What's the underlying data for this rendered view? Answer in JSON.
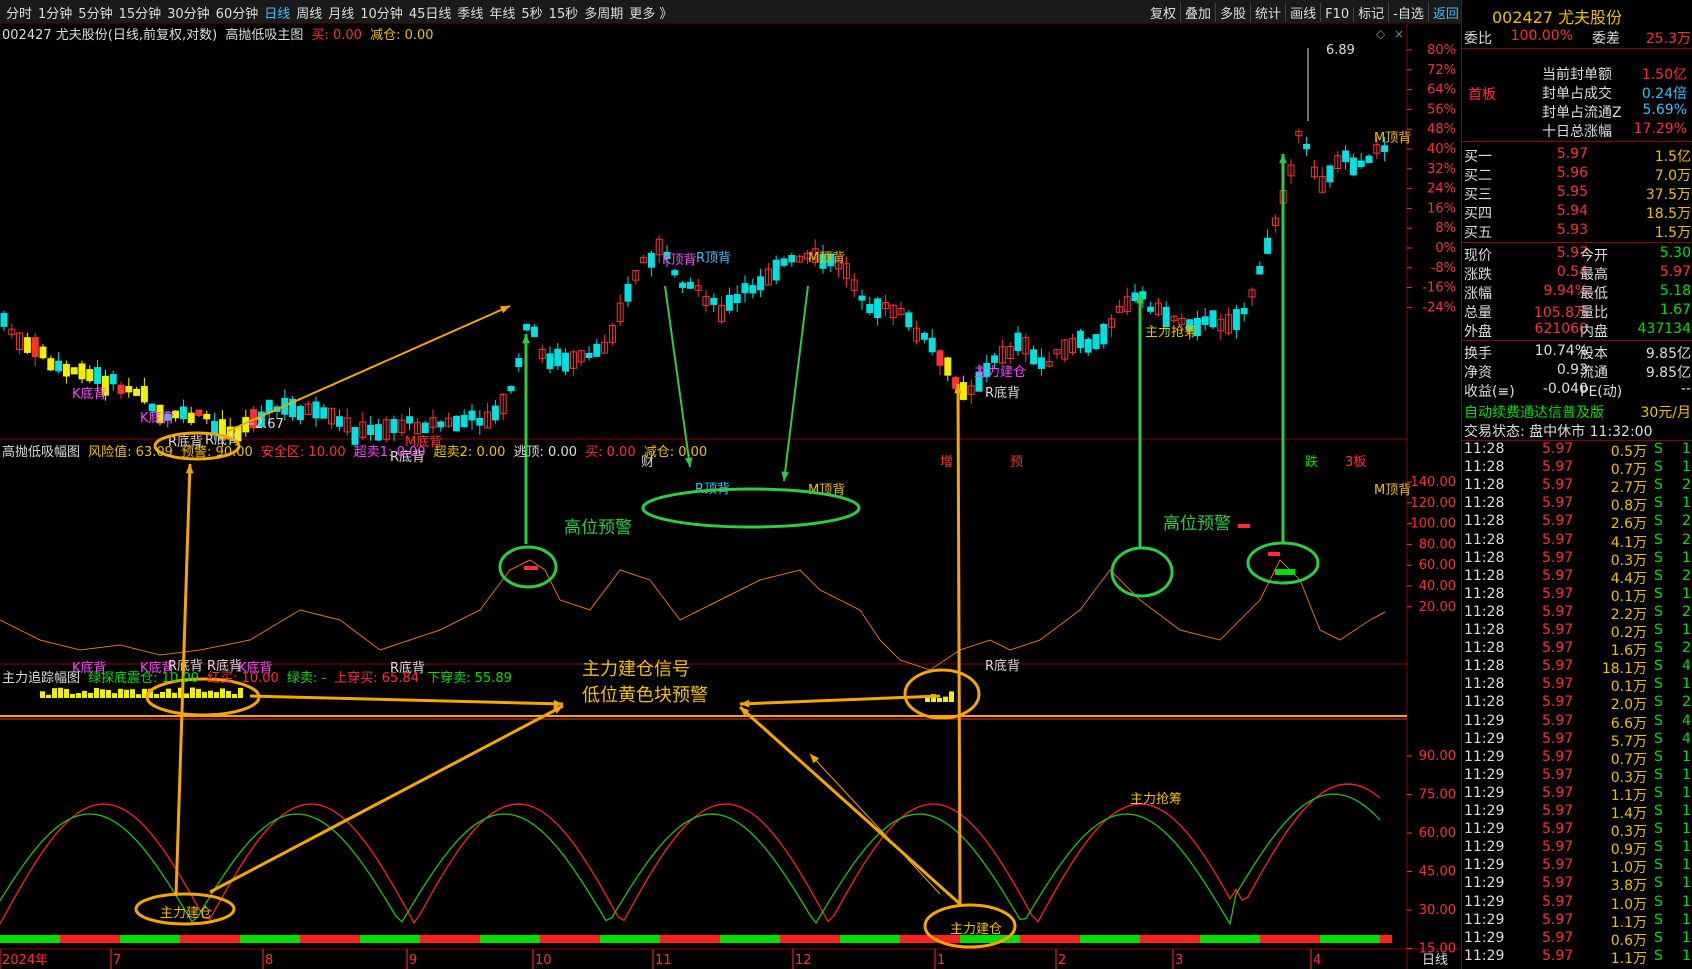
{
  "toolbar": {
    "tabs": [
      "分时",
      "1分钟",
      "5分钟",
      "15分钟",
      "30分钟",
      "60分钟",
      "日线",
      "周线",
      "月线",
      "10分钟",
      "45日线",
      "季线",
      "年线",
      "5秒",
      "15秒",
      "多周期",
      "更多 》"
    ],
    "active_tab": "日线",
    "right_buttons": [
      "复权",
      "叠加",
      "多股",
      "统计",
      "画线",
      "F10",
      "标记",
      "-自选"
    ],
    "back": "返回"
  },
  "main_panel": {
    "title": "002427 尤夫股份(日线,前复权,对数)",
    "indicator": "高抛低吸主图",
    "buy": "买: 0.00",
    "reduce": "减仓: 0.00",
    "right_axis": [
      "80%",
      "72%",
      "64%",
      "56%",
      "48%",
      "40%",
      "32%",
      "24%",
      "16%",
      "8%",
      "0%",
      "-8%",
      "-16%",
      "-24%"
    ],
    "max_price": "6.89",
    "min_price": "2.67",
    "labels": {
      "k_bottom": "K底背",
      "r_bottom": "R底背",
      "r_top": "R顶背",
      "m_top": "M顶背",
      "m_bottom": "M底背",
      "k_top": "K顶背",
      "main_build": "主力建仓",
      "main_grab": "主力抢筹",
      "cai": "财",
      "zeng": "增",
      "yu": "预",
      "die": "跌",
      "ban": "3板"
    }
  },
  "mid_panel": {
    "title": "高抛低吸幅图",
    "fields": [
      "风险值: 63.09",
      "预警: 90.00",
      "安全区: 10.00",
      "超卖1: 0.00",
      "超卖2: 0.00",
      "逃顶: 0.00",
      "买: 0.00",
      "减仓: 0.00"
    ],
    "right_axis": [
      "140.00",
      "120.00",
      "100.00",
      "80.00",
      "60.00",
      "40.00",
      "20.00"
    ],
    "annotations": {
      "high_warn": "高位预警",
      "signal1": "主力建仓信号",
      "signal2": "低位黄色块预警"
    }
  },
  "bottom_panel": {
    "title": "主力追踪幅图",
    "fields": [
      "绿探底震仓: 10.00",
      "红买: 10.00",
      "绿卖: -",
      "上穿买: 65.84",
      "下穿卖: 55.89"
    ],
    "right_axis": [
      "90.00",
      "75.00",
      "60.00",
      "45.00",
      "30.00",
      "15.00"
    ]
  },
  "x_axis": {
    "labels": [
      "2024年",
      "7",
      "8",
      "9",
      "10",
      "11",
      "12",
      "1",
      "2",
      "3",
      "4"
    ],
    "period": "日线"
  },
  "quote": {
    "code": "002427 尤夫股份",
    "weibi_label": "委比",
    "weibi": "100.00%",
    "weicha_label": "委差",
    "weicha": "25.3万",
    "first_board": "首板",
    "seal": [
      [
        "当前封单额",
        "1.50亿"
      ],
      [
        "封单占成交",
        "0.24倍"
      ],
      [
        "封单占流通Z",
        "5.69%"
      ],
      [
        "十日总涨幅",
        "17.29%"
      ]
    ],
    "bids": [
      [
        "买一",
        "5.97",
        "1.5亿"
      ],
      [
        "买二",
        "5.96",
        "7.0万"
      ],
      [
        "买三",
        "5.95",
        "37.5万"
      ],
      [
        "买四",
        "5.94",
        "18.5万"
      ],
      [
        "买五",
        "5.93",
        "1.5万"
      ]
    ],
    "stats": [
      [
        "现价",
        "5.97",
        "今开",
        "5.30"
      ],
      [
        "涨跌",
        "0.54",
        "最高",
        "5.97"
      ],
      [
        "涨幅",
        "9.94%",
        "最低",
        "5.18"
      ],
      [
        "总量",
        "105.8万",
        "量比",
        "1.67"
      ],
      [
        "外盘",
        "621060",
        "内盘",
        "437134"
      ]
    ],
    "stats2": [
      [
        "换手",
        "10.74%",
        "股本",
        "9.85亿"
      ],
      [
        "净资",
        "0.93",
        "流通",
        "9.85亿"
      ],
      [
        "收益(≡)",
        "-0.040",
        "PE(动)",
        "--"
      ]
    ],
    "promo": "自动续费通达信普及版",
    "promo_price": "30元/月",
    "trade_state": "交易状态: 盘中休市 11:32:00",
    "ticks": [
      [
        "11:28",
        "5.97",
        "0.5万",
        "S"
      ],
      [
        "11:28",
        "5.97",
        "0.7万",
        "S"
      ],
      [
        "11:28",
        "5.97",
        "2.7万",
        "S"
      ],
      [
        "11:28",
        "5.97",
        "0.8万",
        "S"
      ],
      [
        "11:28",
        "5.97",
        "2.6万",
        "S"
      ],
      [
        "11:28",
        "5.97",
        "4.1万",
        "S"
      ],
      [
        "11:28",
        "5.97",
        "0.3万",
        "S"
      ],
      [
        "11:28",
        "5.97",
        "4.4万",
        "S"
      ],
      [
        "11:28",
        "5.97",
        "0.1万",
        "S"
      ],
      [
        "11:28",
        "5.97",
        "2.2万",
        "S"
      ],
      [
        "11:28",
        "5.97",
        "0.2万",
        "S"
      ],
      [
        "11:28",
        "5.97",
        "1.6万",
        "S"
      ],
      [
        "11:28",
        "5.97",
        "18.1万",
        "S"
      ],
      [
        "11:28",
        "5.97",
        "0.1万",
        "S"
      ],
      [
        "11:28",
        "5.97",
        "2.0万",
        "S"
      ],
      [
        "11:29",
        "5.97",
        "6.6万",
        "S"
      ],
      [
        "11:29",
        "5.97",
        "5.7万",
        "S"
      ],
      [
        "11:29",
        "5.97",
        "0.7万",
        "S"
      ],
      [
        "11:29",
        "5.97",
        "0.3万",
        "S"
      ],
      [
        "11:29",
        "5.97",
        "1.1万",
        "S"
      ],
      [
        "11:29",
        "5.97",
        "1.4万",
        "S"
      ],
      [
        "11:29",
        "5.97",
        "0.3万",
        "S"
      ],
      [
        "11:29",
        "5.97",
        "0.9万",
        "S"
      ],
      [
        "11:29",
        "5.97",
        "1.0万",
        "S"
      ],
      [
        "11:29",
        "5.97",
        "3.8万",
        "S"
      ],
      [
        "11:29",
        "5.97",
        "1.0万",
        "S"
      ],
      [
        "11:29",
        "5.97",
        "1.1万",
        "S"
      ],
      [
        "11:29",
        "5.97",
        "0.6万",
        "S"
      ],
      [
        "11:29",
        "5.97",
        "1.1万",
        "S"
      ]
    ],
    "tick_last_digits": [
      "1",
      "1",
      "2",
      "1",
      "2",
      "2",
      "1",
      "2",
      "1",
      "2",
      "1",
      "2",
      "4",
      "1",
      "2",
      "4",
      "4",
      "1",
      "1",
      "1",
      "1",
      "1",
      "1",
      "1",
      "1",
      "1",
      "1",
      "1",
      "1"
    ]
  },
  "colors": {
    "up": "#ff3030",
    "down": "#00e0e0",
    "yellow": "#f0f000",
    "orange": "#f7a500",
    "green": "#2ecc40",
    "grid": "#8b0000"
  }
}
